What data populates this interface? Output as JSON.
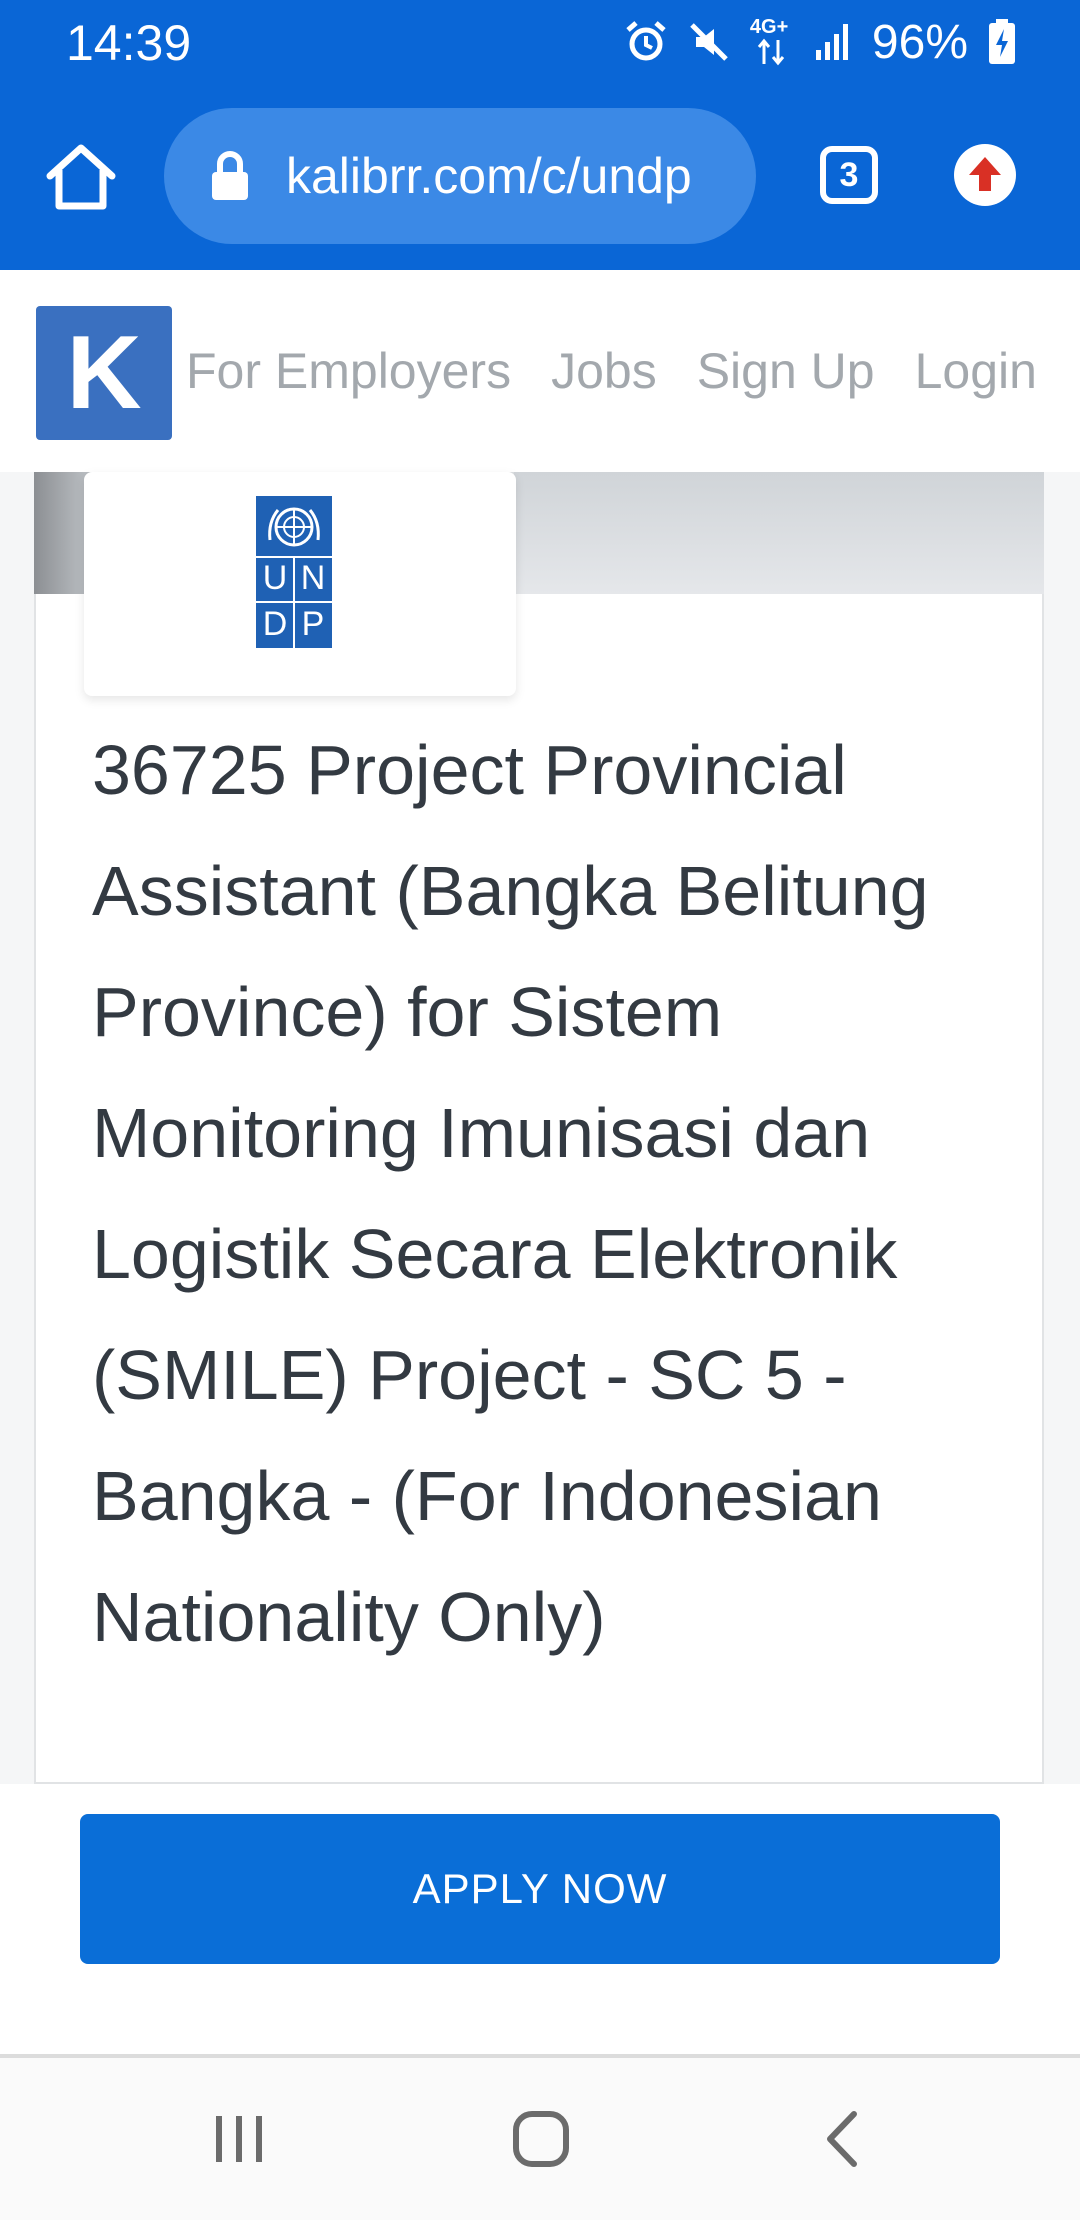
{
  "status_bar": {
    "time": "14:39",
    "network": "4G+",
    "battery": "96%"
  },
  "browser": {
    "url": "kalibrr.com/c/undp",
    "tab_count": "3"
  },
  "site_nav": {
    "logo_letter": "K",
    "links": [
      "For Employers",
      "Jobs",
      "Sign Up",
      "Login"
    ]
  },
  "company": {
    "logo_letters": [
      "U",
      "N",
      "D",
      "P"
    ]
  },
  "job": {
    "title": "36725 Project Provincial Assistant (Bangka Belitung Province) for Sistem Monitoring Imunisasi dan Logistik Secara Elektronik (SMILE) Project - SC 5 - Bangka - (For Indonesian Nationality Only)"
  },
  "apply": {
    "label": "APPLY NOW"
  },
  "colors": {
    "brand_blue": "#0a66d6",
    "apply_blue": "#0a6ed7",
    "logo_blue": "#3a70c0",
    "undp_blue": "#1f61b4"
  }
}
